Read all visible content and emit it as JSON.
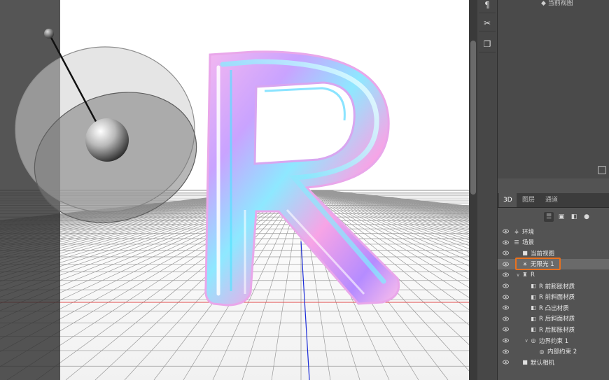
{
  "toolbar_buttons": [
    {
      "name": "paragraph-icon",
      "glyph": "¶"
    },
    {
      "name": "tools-icon",
      "glyph": "✂"
    },
    {
      "name": "copy-icon",
      "glyph": "❐"
    }
  ],
  "properties": {
    "top_fragment": "◆ 当前视图"
  },
  "panel_tabs": [
    "3D",
    "图层",
    "通道"
  ],
  "active_tab": "3D",
  "filters": [
    {
      "name": "filter-scene-icon",
      "glyph": "☰",
      "on": true
    },
    {
      "name": "filter-mesh-icon",
      "glyph": "▣",
      "on": false
    },
    {
      "name": "filter-material-icon",
      "glyph": "◧",
      "on": false
    },
    {
      "name": "filter-light-icon",
      "glyph": "●",
      "on": false
    }
  ],
  "scene_tree": [
    {
      "label": "环境",
      "icon": "environment-icon",
      "glyph": "⚶",
      "indent": 0,
      "twisty": ""
    },
    {
      "label": "场景",
      "icon": "scene-icon",
      "glyph": "☰",
      "indent": 0,
      "twisty": ""
    },
    {
      "label": "当前视图",
      "icon": "camera-icon",
      "glyph": "■",
      "indent": 1,
      "twisty": ""
    },
    {
      "label": "无限光 1",
      "icon": "infinite-light-icon",
      "glyph": "☀",
      "indent": 1,
      "twisty": "",
      "selected": true
    },
    {
      "label": "R",
      "icon": "mesh-icon",
      "glyph": "♜",
      "indent": 1,
      "twisty": "∨"
    },
    {
      "label": "R 前膨胀材质",
      "icon": "material-icon",
      "glyph": "◧",
      "indent": 2,
      "twisty": ""
    },
    {
      "label": "R 前斜面材质",
      "icon": "material-icon",
      "glyph": "◧",
      "indent": 2,
      "twisty": ""
    },
    {
      "label": "R 凸出材质",
      "icon": "material-icon",
      "glyph": "◧",
      "indent": 2,
      "twisty": ""
    },
    {
      "label": "R 后斜面材质",
      "icon": "material-icon",
      "glyph": "◧",
      "indent": 2,
      "twisty": ""
    },
    {
      "label": "R 后膨胀材质",
      "icon": "material-icon",
      "glyph": "◧",
      "indent": 2,
      "twisty": ""
    },
    {
      "label": "边界约束 1",
      "icon": "constraint-icon",
      "glyph": "◎",
      "indent": 2,
      "twisty": "∨"
    },
    {
      "label": "内部约束 2",
      "icon": "constraint-icon",
      "glyph": "◎",
      "indent": 3,
      "twisty": ""
    },
    {
      "label": "默认相机",
      "icon": "camera-icon",
      "glyph": "■",
      "indent": 1,
      "twisty": ""
    }
  ]
}
